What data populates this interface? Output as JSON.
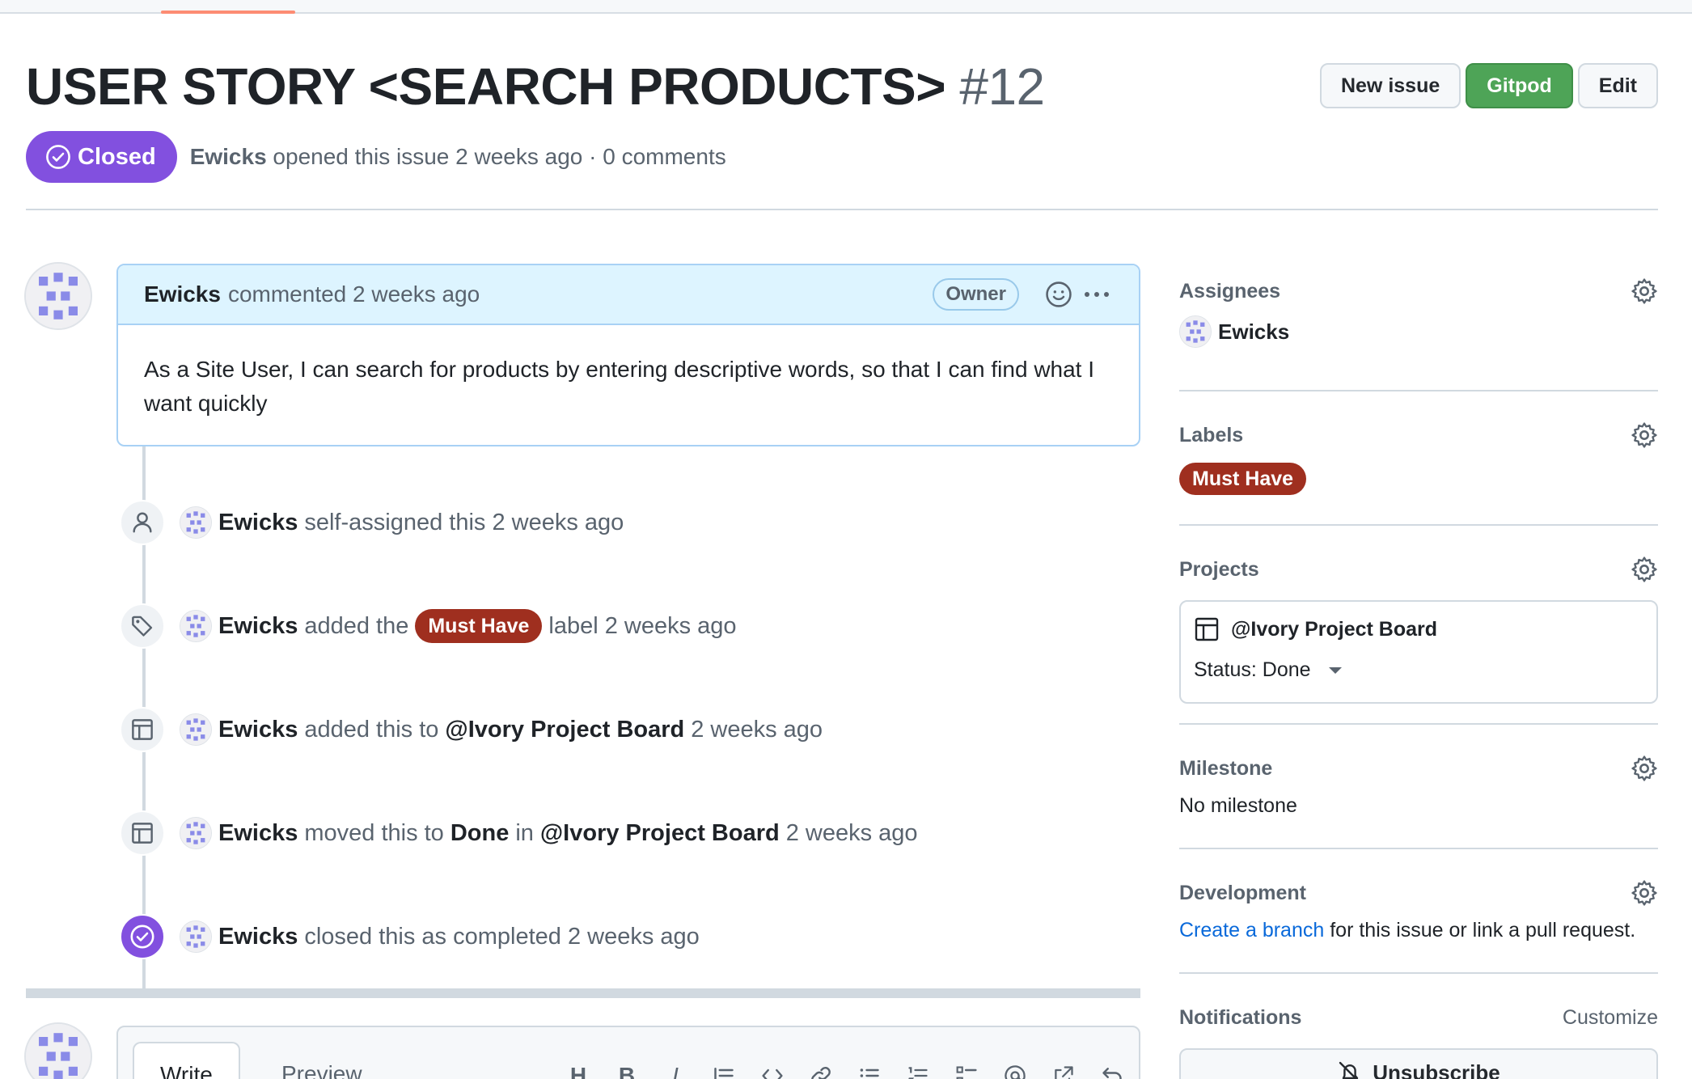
{
  "issue": {
    "title": "USER STORY <SEARCH PRODUCTS>",
    "number": "#12",
    "state": "Closed",
    "author": "Ewicks",
    "opened_text": "opened this issue 2 weeks ago · 0 comments"
  },
  "actions": {
    "new_issue": "New issue",
    "gitpod": "Gitpod",
    "edit": "Edit"
  },
  "comment": {
    "author": "Ewicks",
    "meta": "commented 2 weeks ago",
    "role_badge": "Owner",
    "body": "As a Site User, I can search for products by entering descriptive words, so that I can find what I want quickly"
  },
  "events": [
    {
      "actor": "Ewicks",
      "text": "self-assigned this 2 weeks ago",
      "icon": "person-icon"
    },
    {
      "actor": "Ewicks",
      "pre": "added the",
      "label": "Must Have",
      "post": "label 2 weeks ago",
      "icon": "tag-icon"
    },
    {
      "actor": "Ewicks",
      "pre": "added this to",
      "project": "@Ivory Project Board",
      "post": "2 weeks ago",
      "icon": "table-icon"
    },
    {
      "actor": "Ewicks",
      "pre": "moved this to",
      "column": "Done",
      "mid": "in",
      "project": "@Ivory Project Board",
      "post": "2 weeks ago",
      "icon": "table-icon"
    },
    {
      "actor": "Ewicks",
      "text": "closed this as completed 2 weeks ago",
      "icon": "check-circle-icon"
    }
  ],
  "composer": {
    "write_tab": "Write",
    "preview_tab": "Preview",
    "toolbar": [
      "H",
      "B",
      "I",
      "quote",
      "code",
      "link",
      "ul",
      "ol",
      "tasklist",
      "mention",
      "reference",
      "undo"
    ]
  },
  "sidebar": {
    "assignees": {
      "heading": "Assignees",
      "name": "Ewicks"
    },
    "labels": {
      "heading": "Labels",
      "label": "Must Have"
    },
    "projects": {
      "heading": "Projects",
      "project_name": "@Ivory Project Board",
      "status": "Status: Done"
    },
    "milestone": {
      "heading": "Milestone",
      "value": "No milestone"
    },
    "development": {
      "heading": "Development",
      "link_text": "Create a branch",
      "rest_text": "for this issue or link a pull request."
    },
    "notifications": {
      "heading": "Notifications",
      "customize": "Customize",
      "unsubscribe": "Unsubscribe"
    }
  },
  "colors": {
    "closed_purple": "#8250df",
    "gitpod_green": "#4ea457",
    "label_red": "#9f2f1f",
    "link_blue": "#0969da"
  }
}
